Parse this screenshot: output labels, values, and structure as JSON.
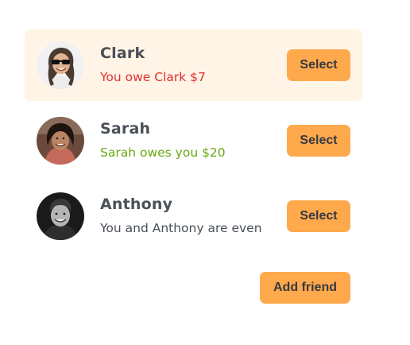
{
  "friends": [
    {
      "name": "Clark",
      "balance_text": "You owe Clark $7",
      "balance_status": "owe",
      "selected": true,
      "select_label": "Select",
      "avatar": "clark-avatar"
    },
    {
      "name": "Sarah",
      "balance_text": "Sarah owes you $20",
      "balance_status": "owed",
      "selected": false,
      "select_label": "Select",
      "avatar": "sarah-avatar"
    },
    {
      "name": "Anthony",
      "balance_text": "You and Anthony are even",
      "balance_status": "even",
      "selected": false,
      "select_label": "Select",
      "avatar": "anthony-avatar"
    }
  ],
  "add_friend_label": "Add friend",
  "colors": {
    "accent": "#ffa94d",
    "selected_bg": "#fff4e6",
    "owe": "#e03131",
    "owed": "#66a80f",
    "text": "#495057"
  }
}
